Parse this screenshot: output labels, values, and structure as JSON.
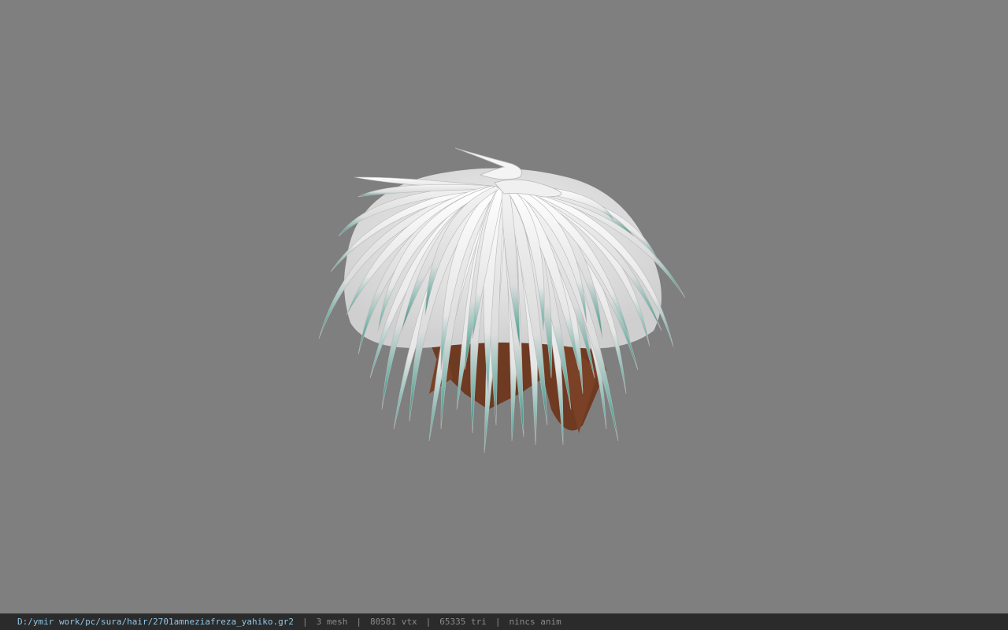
{
  "viewport": {
    "background_color": "#7f7f7f",
    "model": {
      "description_icon": "hair-mesh",
      "hair_color": "#ececec",
      "tip_color": "#3f9a8a",
      "scalp_color": "#7a3f22"
    }
  },
  "status_bar": {
    "file_path": "D:/ymir work/pc/sura/hair/2701amneziafreza_yahiko.gr2",
    "separator": "|",
    "mesh_count": "3 mesh",
    "vertex_count": "80581 vtx",
    "triangle_count": "65335 tri",
    "anim_status": "nincs anim",
    "path_color": "#8ec7e8",
    "bg_color": "#2b2b2b"
  }
}
